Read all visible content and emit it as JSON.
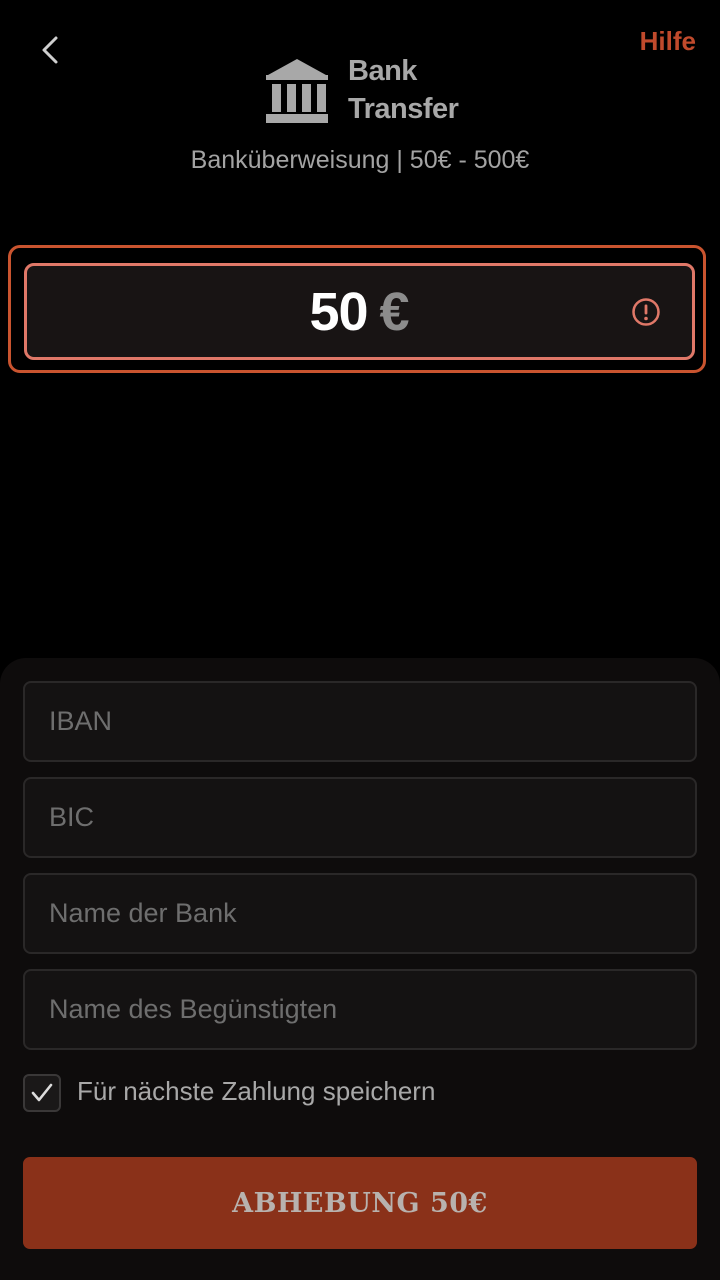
{
  "header": {
    "back_icon": "chevron-left-icon",
    "help_label": "Hilfe",
    "brand_line1": "Bank",
    "brand_line2": "Transfer",
    "brand_icon": "bank-building-icon",
    "subtitle": "Banküberweisung | 50€ - 500€"
  },
  "amount": {
    "value": "50",
    "currency": "€",
    "status_icon": "alert-circle-icon"
  },
  "form": {
    "iban_placeholder": "IBAN",
    "bic_placeholder": "BIC",
    "bank_name_placeholder": "Name der Bank",
    "beneficiary_placeholder": "Name des Begünstigten",
    "save_checked": true,
    "save_label": "Für nächste Zahlung speichern",
    "submit_label": "ABHEBUNG 50€"
  },
  "colors": {
    "accent": "#c04a2c",
    "error_border": "#e07868",
    "button_bg": "#8a3119",
    "background": "#000000"
  }
}
